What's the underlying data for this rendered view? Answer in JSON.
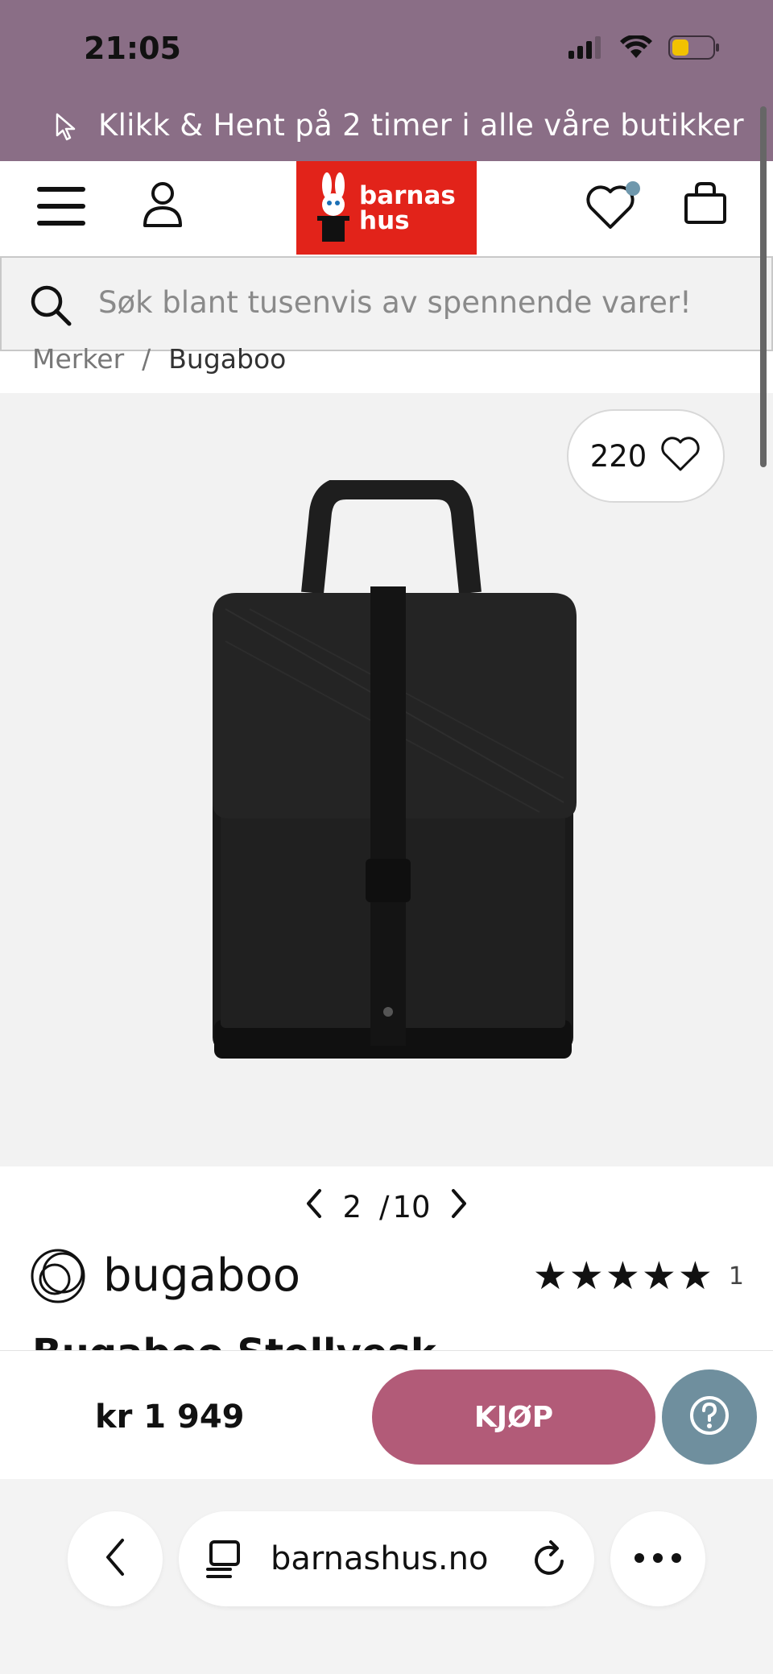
{
  "status_bar": {
    "time": "21:05",
    "battery_color": "#f2c200"
  },
  "promo": {
    "text": "Klikk & Hent på 2 timer i alle våre butikker",
    "icon": "cursor-icon"
  },
  "header": {
    "logo_line1": "barnas",
    "logo_line2": "hus",
    "brand_color": "#e2231a",
    "wishlist_has_badge": true
  },
  "search": {
    "placeholder": "Søk blant tusenvis av spennende varer!"
  },
  "breadcrumb": {
    "items": [
      "Merker",
      "Bugaboo"
    ],
    "separator": "/"
  },
  "gallery": {
    "favorites_count": "220",
    "current": "2",
    "separator": "/",
    "total": "10"
  },
  "product": {
    "brand": "bugaboo",
    "rating_stars": "★★★★★",
    "rating_count": "1",
    "title_partial": "Bugaboo Stellvesk",
    "price": "kr 1 949"
  },
  "actions": {
    "buy_label": "KJØP",
    "buy_color": "#b25b78",
    "help_color": "#6f8f9e"
  },
  "browser": {
    "url": "barnashus.no"
  }
}
